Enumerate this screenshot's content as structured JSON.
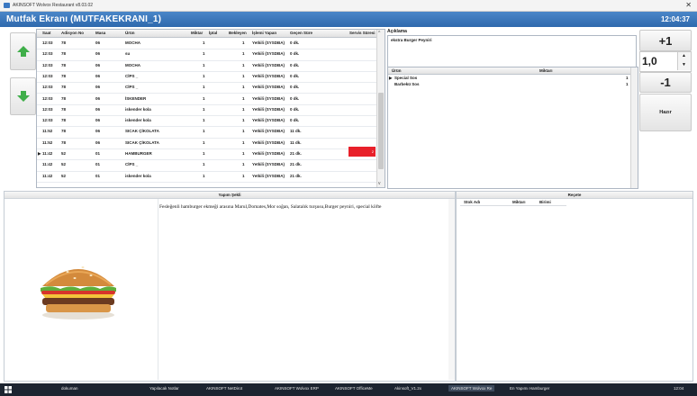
{
  "window": {
    "title": "AKINSOFT Wolvox Restaurant v8.03.02",
    "close": "✕"
  },
  "header": {
    "title": "Mutfak Ekranı (MUTFAKEKRANI_1)",
    "clock": "12:04:37"
  },
  "grid": {
    "columns": [
      "Saat",
      "Adisyon No",
      "Masa",
      "Ürün",
      "Miktar",
      "İptal",
      "Bekleyen",
      "İşlemi Yapan",
      "Geçen Süre",
      "Servis Süresi"
    ],
    "rows": [
      [
        "12:03",
        "78",
        "06",
        "MOCHA",
        "1",
        "",
        "1",
        "Yetkili (SYSDBA)",
        "0 dk.",
        ""
      ],
      [
        "12:03",
        "78",
        "06",
        "su",
        "1",
        "",
        "1",
        "Yetkili (SYSDBA)",
        "0 dk.",
        ""
      ],
      [
        "12:03",
        "78",
        "06",
        "MOCHA",
        "1",
        "",
        "1",
        "Yetkili (SYSDBA)",
        "0 dk.",
        ""
      ],
      [
        "12:03",
        "78",
        "06",
        "CİPS _",
        "1",
        "",
        "1",
        "Yetkili (SYSDBA)",
        "0 dk.",
        ""
      ],
      [
        "12:03",
        "78",
        "06",
        "CİPS _",
        "1",
        "",
        "1",
        "Yetkili (SYSDBA)",
        "0 dk.",
        ""
      ],
      [
        "12:03",
        "78",
        "06",
        "İSKENDER",
        "1",
        "",
        "1",
        "Yetkili (SYSDBA)",
        "0 dk.",
        ""
      ],
      [
        "12:03",
        "78",
        "06",
        "iskender kola",
        "1",
        "",
        "1",
        "Yetkili (SYSDBA)",
        "0 dk.",
        ""
      ],
      [
        "12:03",
        "78",
        "06",
        "iskender kola",
        "1",
        "",
        "1",
        "Yetkili (SYSDBA)",
        "0 dk.",
        ""
      ],
      [
        "11:52",
        "78",
        "06",
        "SICAK ÇİKOLATA",
        "1",
        "",
        "1",
        "Yetkili (SYSDBA)",
        "11 dk.",
        ""
      ],
      [
        "11:52",
        "78",
        "06",
        "SICAK ÇİKOLATA",
        "1",
        "",
        "1",
        "Yetkili (SYSDBA)",
        "11 dk.",
        ""
      ],
      [
        "11:42",
        "52",
        "01",
        "HAMBURGER",
        "1",
        "",
        "1",
        "Yetkili (SYSDBA)",
        "21 dk.",
        "2"
      ],
      [
        "11:42",
        "52",
        "01",
        "CİPS _",
        "1",
        "",
        "1",
        "Yetkili (SYSDBA)",
        "21 dk.",
        ""
      ],
      [
        "11:42",
        "52",
        "01",
        "iskender kola",
        "1",
        "",
        "1",
        "Yetkili (SYSDBA)",
        "21 dk.",
        ""
      ]
    ],
    "selected_row": 10,
    "pointer": "▶"
  },
  "aciklama": {
    "label": "Açıklama",
    "value": "ekstra Burger Peyniri"
  },
  "ekstra": {
    "columns": [
      "Ürün",
      "Miktarı"
    ],
    "rows": [
      {
        "name": "Special Sos",
        "qty": "1",
        "pointer": "▶"
      },
      {
        "name": "Barbekü Sos",
        "qty": "1",
        "pointer": ""
      }
    ]
  },
  "buttons": {
    "plus": "+1",
    "minus": "-1",
    "ready": "Hazır"
  },
  "quantity": {
    "value": "1,0",
    "up": "▲",
    "down": "▼"
  },
  "yapim": {
    "title": "Yapım Şekli",
    "text": "Fesleğenli hamburger ekmeği arasına Marul,Domates,Mor soğan, Salatalık turşusu,Burger peyniri, special köfte"
  },
  "recete": {
    "title": "Reçete",
    "columns": [
      "Stok Adı",
      "Miktarı",
      "Birimi"
    ]
  },
  "taskbar": {
    "items": [
      "dokuman",
      "Yapılacak Notlar",
      "AKINSOFT NetDirot",
      "AKINSOFT Wolvox ERP",
      "AKINSOFT OfficeMe",
      "Akinsoft_V1.2x",
      "AKINSOFT Wolvox Re",
      "En Yapımı Hamburger"
    ],
    "active_index": 6,
    "clock": "12:04"
  },
  "colors": {
    "header": "#3a76bc",
    "alert": "#e8202a",
    "arrow": "#3fae49"
  }
}
